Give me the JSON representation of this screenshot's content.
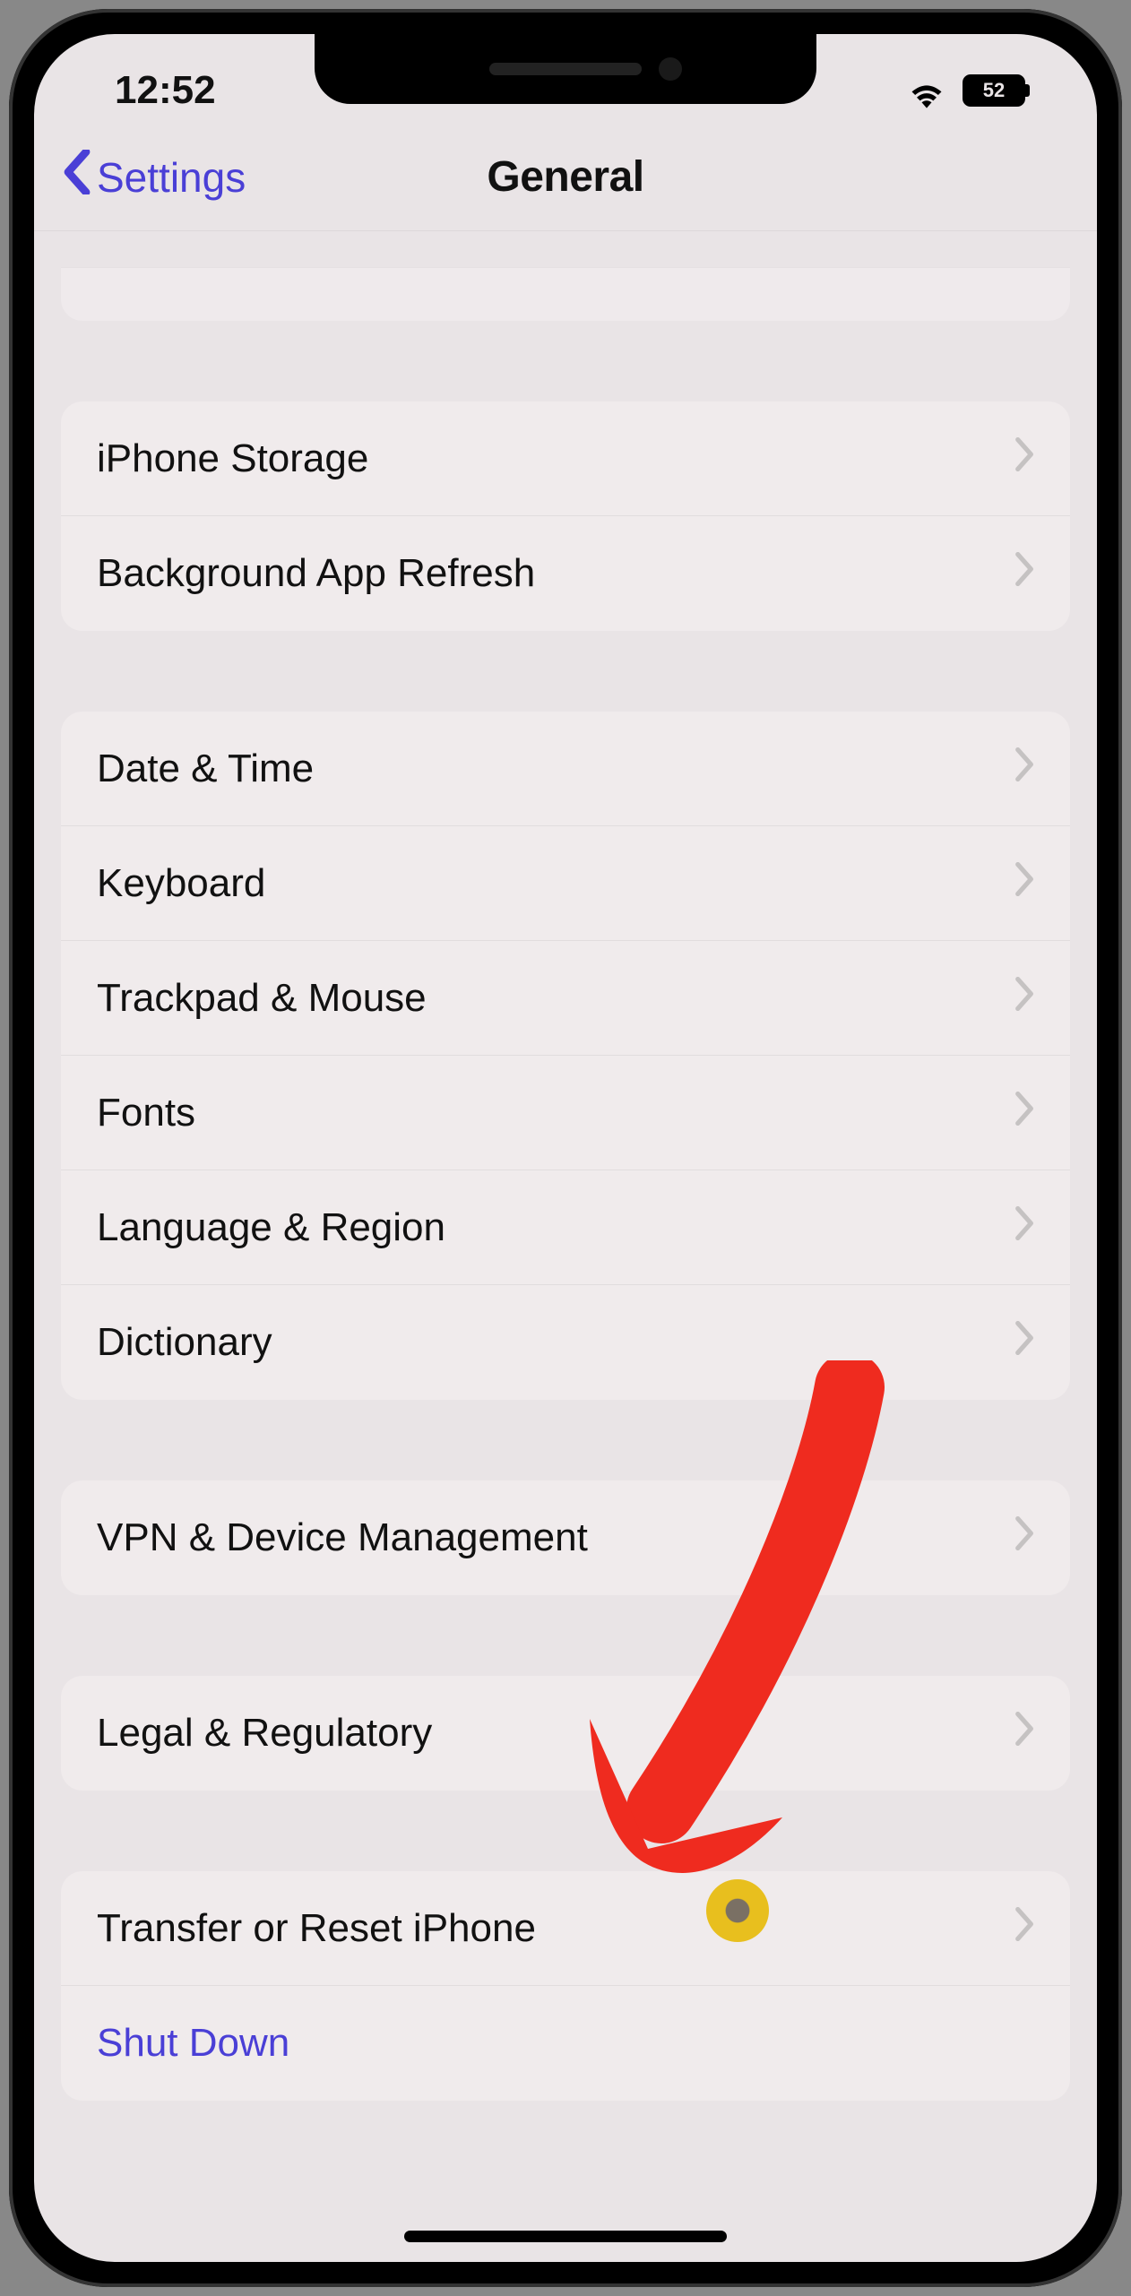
{
  "status": {
    "time": "12:52",
    "battery": "52"
  },
  "nav": {
    "back": "Settings",
    "title": "General"
  },
  "groups": [
    {
      "rows": [
        {
          "id": "iphone-storage",
          "label": "iPhone Storage"
        },
        {
          "id": "background-app-refresh",
          "label": "Background App Refresh"
        }
      ]
    },
    {
      "rows": [
        {
          "id": "date-time",
          "label": "Date & Time"
        },
        {
          "id": "keyboard",
          "label": "Keyboard"
        },
        {
          "id": "trackpad-mouse",
          "label": "Trackpad & Mouse"
        },
        {
          "id": "fonts",
          "label": "Fonts"
        },
        {
          "id": "language-region",
          "label": "Language & Region"
        },
        {
          "id": "dictionary",
          "label": "Dictionary"
        }
      ]
    },
    {
      "rows": [
        {
          "id": "vpn-device-management",
          "label": "VPN & Device Management"
        }
      ]
    },
    {
      "rows": [
        {
          "id": "legal-regulatory",
          "label": "Legal & Regulatory"
        }
      ]
    },
    {
      "rows": [
        {
          "id": "transfer-reset",
          "label": "Transfer or Reset iPhone"
        },
        {
          "id": "shut-down",
          "label": "Shut Down",
          "style": "blue",
          "noChevron": true
        }
      ]
    }
  ]
}
